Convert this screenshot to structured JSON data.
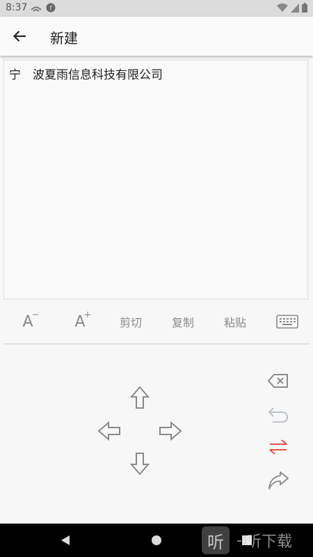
{
  "status_bar": {
    "time": "8:37",
    "left_icons": [
      "cast-icon",
      "app-notification-icon"
    ],
    "right_icons": [
      "wifi-icon",
      "signal-icon",
      "battery-icon"
    ]
  },
  "app_bar": {
    "title": "新建",
    "back_icon": "arrow-left-icon"
  },
  "editor": {
    "content": "宁　波夏雨信息科技有限公司"
  },
  "toolbar": {
    "font_decrease_label": "A",
    "font_decrease_sup": "−",
    "font_increase_label": "A",
    "font_increase_sup": "+",
    "cut_label": "剪切",
    "copy_label": "复制",
    "paste_label": "粘贴",
    "keyboard_icon": "keyboard-icon"
  },
  "pad": {
    "arrows": [
      "arrow-up-icon",
      "arrow-left-icon",
      "arrow-right-icon",
      "arrow-down-icon"
    ],
    "side_buttons": [
      "backspace-icon",
      "undo-icon",
      "swap-icon",
      "redo-icon"
    ],
    "accent_color": "#e53935",
    "icon_color": "#8a8a8a"
  },
  "nav_bar": {
    "buttons": [
      "back-triangle-icon",
      "home-circle-icon",
      "recent-square-icon"
    ],
    "watermark_logo": "听",
    "watermark_text": "听下载"
  }
}
